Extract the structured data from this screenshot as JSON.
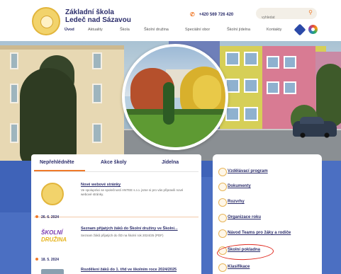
{
  "header": {
    "school_name_line1": "Základní škola",
    "school_name_line2": "Ledeč nad Sázavou",
    "phone": "+420 569 726 420",
    "search_placeholder": "vyhledat"
  },
  "nav": {
    "items": [
      "Úvod",
      "Aktuality",
      "Škola",
      "Školní družina",
      "Speciální obor",
      "Školní jídelna",
      "Kontakty"
    ],
    "active_index": 0
  },
  "tabs": [
    "Nepřehlédněte",
    "Akce školy",
    "Jídelna"
  ],
  "active_tab": 0,
  "news": [
    {
      "date": "",
      "title": "Nové webové stránky",
      "body": "Ve spolupráci se společností ANTEE s.r.o. jsme si pro vás připravili nové webové stránky."
    },
    {
      "date": "26. 6. 2024",
      "title": "Seznam přijatých žáků do Školní družiny ve Školní...",
      "body": "Seznam žáků přijatých do ŠD na školní rok 2024/25 (PDF)",
      "thumb_text_1": "ŠKOLNÍ",
      "thumb_text_2": "DRUŽINA"
    },
    {
      "date": "18. 5. 2024",
      "title": "Rozdělení žáků do 1. tříd ve školním roce 2024/2025",
      "body": ""
    }
  ],
  "menu": [
    "Vzdělávací program",
    "Dokumenty",
    "Rozvrhy",
    "Organizace roku",
    "Návod Teams pro žáky a rodiče",
    "Školní pokladna",
    "Klasifikace"
  ],
  "highlighted_menu_item": "Školní pokladna",
  "colors": {
    "navy": "#2b2d6b",
    "accent_orange": "#f07a2a",
    "blue_bg": "#3f63b8",
    "highlight_red": "#e0291f"
  },
  "icons": [
    "phone-icon",
    "search-icon",
    "accessibility-icon",
    "color-wheel-icon"
  ]
}
